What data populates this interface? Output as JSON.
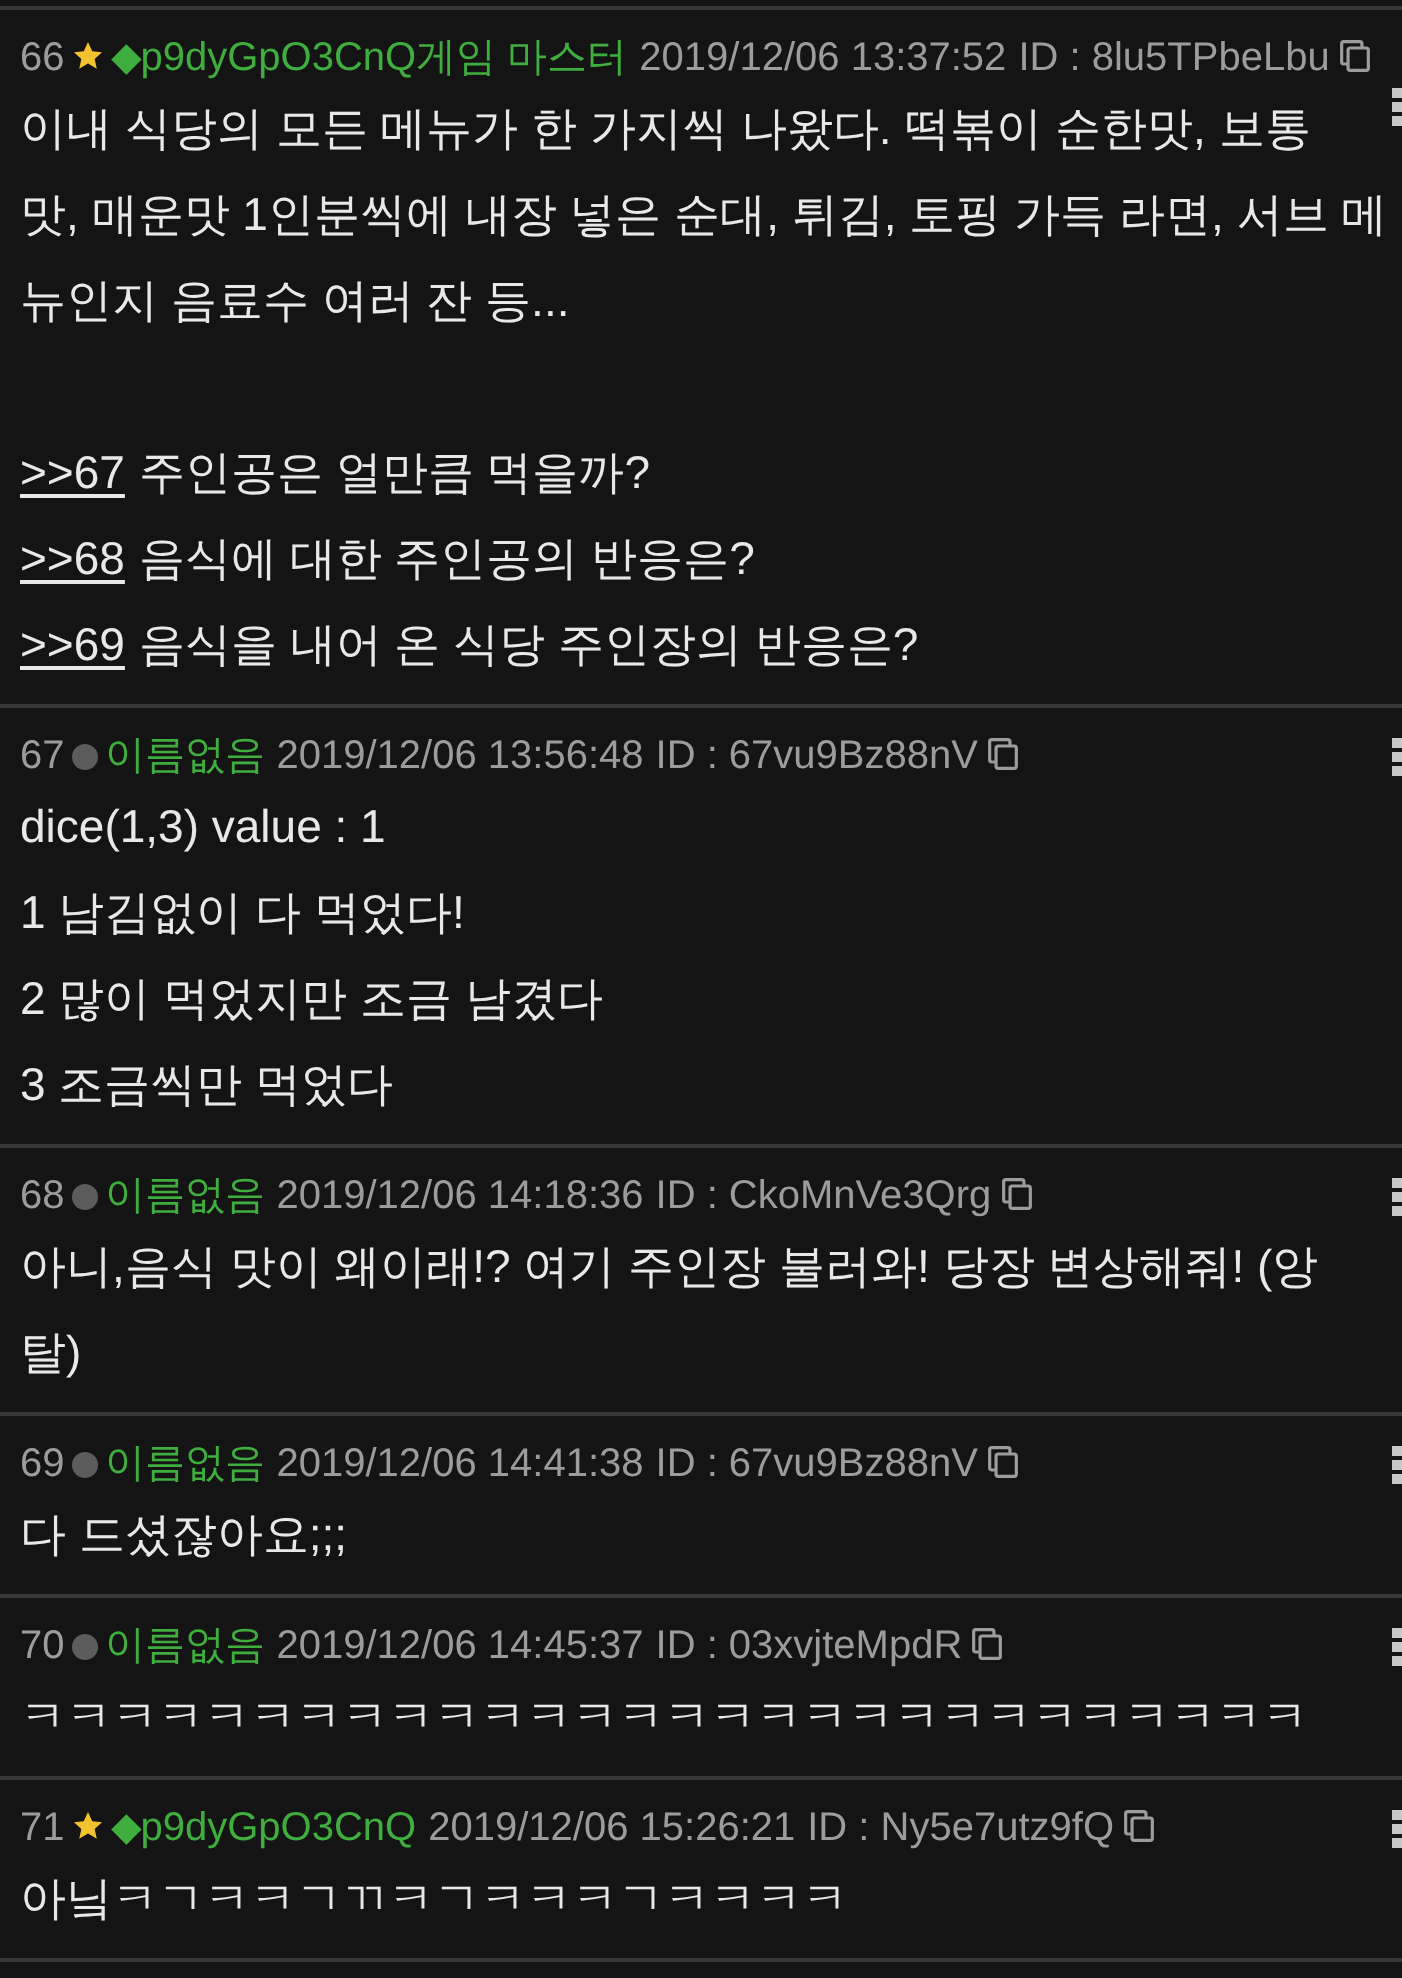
{
  "posts": [
    {
      "number": "66",
      "owner": true,
      "name": "◆p9dyGpO3CnQ게임 마스터",
      "date": "2019/12/06 13:37:52",
      "id": "ID : 8lu5TPbeLbu",
      "body": [
        {
          "kind": "text",
          "text": "이내 식당의 모든 메뉴가 한 가지씩 나왔다. 떡볶이 순한맛, 보통\n맛, 매운맛 1인분씩에 내장 넣은 순대, 튀김, 토핑 가득 라면, 서브 메\n뉴인지 음료수 여러 잔 등..."
        },
        {
          "kind": "reply",
          "link": ">>67",
          "text": "주인공은 얼만큼 먹을까?"
        },
        {
          "kind": "reply",
          "link": ">>68",
          "text": "음식에 대한 주인공의 반응은?"
        },
        {
          "kind": "reply",
          "link": ">>69",
          "text": "음식을 내어 온 식당 주인장의 반응은?"
        }
      ]
    },
    {
      "number": "67",
      "owner": false,
      "name": "이름없음",
      "date": "2019/12/06 13:56:48",
      "id": "ID : 67vu9Bz88nV",
      "body": [
        {
          "kind": "text",
          "text": "dice(1,3) value : 1"
        },
        {
          "kind": "text",
          "text": "1 남김없이 다 먹었다!"
        },
        {
          "kind": "text",
          "text": "2 많이 먹었지만 조금 남겼다"
        },
        {
          "kind": "text",
          "text": "3 조금씩만 먹었다"
        }
      ]
    },
    {
      "number": "68",
      "owner": false,
      "name": "이름없음",
      "date": "2019/12/06 14:18:36",
      "id": "ID : CkoMnVe3Qrg",
      "body": [
        {
          "kind": "text",
          "text": "아니,음식 맛이 왜이래!? 여기 주인장 불러와! 당장 변상해줘! (앙\n탈)"
        }
      ]
    },
    {
      "number": "69",
      "owner": false,
      "name": "이름없음",
      "date": "2019/12/06 14:41:38",
      "id": "ID : 67vu9Bz88nV",
      "body": [
        {
          "kind": "text",
          "text": "다 드셨잖아요;;;"
        }
      ]
    },
    {
      "number": "70",
      "owner": false,
      "name": "이름없음",
      "date": "2019/12/06 14:45:37",
      "id": "ID : 03xvjteMpdR",
      "body": [
        {
          "kind": "text",
          "text": "ㅋㅋㅋㅋㅋㅋㅋㅋㅋㅋㅋㅋㅋㅋㅋㅋㅋㅋㅋㅋㅋㅋㅋㅋㅋㅋㅋㅋ"
        }
      ]
    },
    {
      "number": "71",
      "owner": true,
      "name": "◆p9dyGpO3CnQ",
      "date": "2019/12/06 15:26:21",
      "id": "ID : Ny5e7utz9fQ",
      "body": [
        {
          "kind": "text",
          "text": "아닠ㅋㄱㅋㅋㄱㄲㅋㄱㅋㅋㅋㄱㅋㅋㅋㅋ"
        }
      ]
    }
  ]
}
